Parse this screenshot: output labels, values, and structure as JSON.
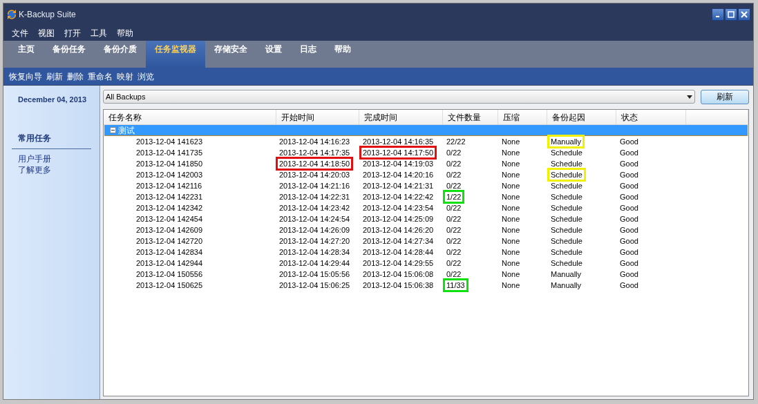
{
  "window": {
    "title": "K-Backup Suite"
  },
  "menu": [
    "文件",
    "视图",
    "打开",
    "工具",
    "帮助"
  ],
  "tabs": [
    {
      "label": "主页",
      "selected": false
    },
    {
      "label": "备份任务",
      "selected": false
    },
    {
      "label": "备份介质",
      "selected": false
    },
    {
      "label": "任务监视器",
      "selected": true
    },
    {
      "label": "存储安全",
      "selected": false
    },
    {
      "label": "设置",
      "selected": false
    },
    {
      "label": "日志",
      "selected": false
    },
    {
      "label": "帮助",
      "selected": false
    }
  ],
  "toolbar": [
    "恢复向导",
    "刷新",
    "删除",
    "重命名",
    "映射",
    "浏览"
  ],
  "sidebar": {
    "date": "December 04, 2013",
    "section_title": "常用任务",
    "links": [
      "用户手册",
      "了解更多"
    ]
  },
  "filter": {
    "value": "All Backups",
    "button": "刷新"
  },
  "table": {
    "columns": [
      "任务名称",
      "开始时间",
      "完成时间",
      "文件数量",
      "压缩",
      "备份起因",
      "状态"
    ],
    "group": {
      "label": "测试",
      "expanded": true
    },
    "rows": [
      [
        {
          "text": "2013-12-04 141623"
        },
        {
          "text": "2013-12-04 14:16:23"
        },
        {
          "text": "2013-12-04 14:16:35"
        },
        {
          "text": "22/22"
        },
        {
          "text": "None"
        },
        {
          "text": "Manually",
          "color": "#f0f000"
        },
        {
          "text": "Good"
        }
      ],
      [
        {
          "text": "2013-12-04 141735"
        },
        {
          "text": "2013-12-04 14:17:35"
        },
        {
          "text": "2013-12-04 14:17:50",
          "color": "#e01010"
        },
        {
          "text": "0/22"
        },
        {
          "text": "None"
        },
        {
          "text": "Schedule"
        },
        {
          "text": "Good"
        }
      ],
      [
        {
          "text": "2013-12-04 141850"
        },
        {
          "text": "2013-12-04 14:18:50",
          "color": "#e01010"
        },
        {
          "text": "2013-12-04 14:19:03"
        },
        {
          "text": "0/22"
        },
        {
          "text": "None"
        },
        {
          "text": "Schedule"
        },
        {
          "text": "Good"
        }
      ],
      [
        {
          "text": "2013-12-04 142003"
        },
        {
          "text": "2013-12-04 14:20:03"
        },
        {
          "text": "2013-12-04 14:20:16"
        },
        {
          "text": "0/22"
        },
        {
          "text": "None"
        },
        {
          "text": "Schedule",
          "color": "#f0f000"
        },
        {
          "text": "Good"
        }
      ],
      [
        {
          "text": "2013-12-04 142116"
        },
        {
          "text": "2013-12-04 14:21:16"
        },
        {
          "text": "2013-12-04 14:21:31"
        },
        {
          "text": "0/22"
        },
        {
          "text": "None"
        },
        {
          "text": "Schedule"
        },
        {
          "text": "Good"
        }
      ],
      [
        {
          "text": "2013-12-04 142231"
        },
        {
          "text": "2013-12-04 14:22:31"
        },
        {
          "text": "2013-12-04 14:22:42"
        },
        {
          "text": "1/22",
          "color": "#10e010"
        },
        {
          "text": "None"
        },
        {
          "text": "Schedule"
        },
        {
          "text": "Good"
        }
      ],
      [
        {
          "text": "2013-12-04 142342"
        },
        {
          "text": "2013-12-04 14:23:42"
        },
        {
          "text": "2013-12-04 14:23:54"
        },
        {
          "text": "0/22"
        },
        {
          "text": "None"
        },
        {
          "text": "Schedule"
        },
        {
          "text": "Good"
        }
      ],
      [
        {
          "text": "2013-12-04 142454"
        },
        {
          "text": "2013-12-04 14:24:54"
        },
        {
          "text": "2013-12-04 14:25:09"
        },
        {
          "text": "0/22"
        },
        {
          "text": "None"
        },
        {
          "text": "Schedule"
        },
        {
          "text": "Good"
        }
      ],
      [
        {
          "text": "2013-12-04 142609"
        },
        {
          "text": "2013-12-04 14:26:09"
        },
        {
          "text": "2013-12-04 14:26:20"
        },
        {
          "text": "0/22"
        },
        {
          "text": "None"
        },
        {
          "text": "Schedule"
        },
        {
          "text": "Good"
        }
      ],
      [
        {
          "text": "2013-12-04 142720"
        },
        {
          "text": "2013-12-04 14:27:20"
        },
        {
          "text": "2013-12-04 14:27:34"
        },
        {
          "text": "0/22"
        },
        {
          "text": "None"
        },
        {
          "text": "Schedule"
        },
        {
          "text": "Good"
        }
      ],
      [
        {
          "text": "2013-12-04 142834"
        },
        {
          "text": "2013-12-04 14:28:34"
        },
        {
          "text": "2013-12-04 14:28:44"
        },
        {
          "text": "0/22"
        },
        {
          "text": "None"
        },
        {
          "text": "Schedule"
        },
        {
          "text": "Good"
        }
      ],
      [
        {
          "text": "2013-12-04 142944"
        },
        {
          "text": "2013-12-04 14:29:44"
        },
        {
          "text": "2013-12-04 14:29:55"
        },
        {
          "text": "0/22"
        },
        {
          "text": "None"
        },
        {
          "text": "Schedule"
        },
        {
          "text": "Good"
        }
      ],
      [
        {
          "text": "2013-12-04 150556"
        },
        {
          "text": "2013-12-04 15:05:56"
        },
        {
          "text": "2013-12-04 15:06:08"
        },
        {
          "text": "0/22"
        },
        {
          "text": "None"
        },
        {
          "text": "Manually"
        },
        {
          "text": "Good"
        }
      ],
      [
        {
          "text": "2013-12-04 150625"
        },
        {
          "text": "2013-12-04 15:06:25"
        },
        {
          "text": "2013-12-04 15:06:38"
        },
        {
          "text": "11/33",
          "color": "#10e010"
        },
        {
          "text": "None"
        },
        {
          "text": "Manually"
        },
        {
          "text": "Good"
        }
      ]
    ]
  }
}
